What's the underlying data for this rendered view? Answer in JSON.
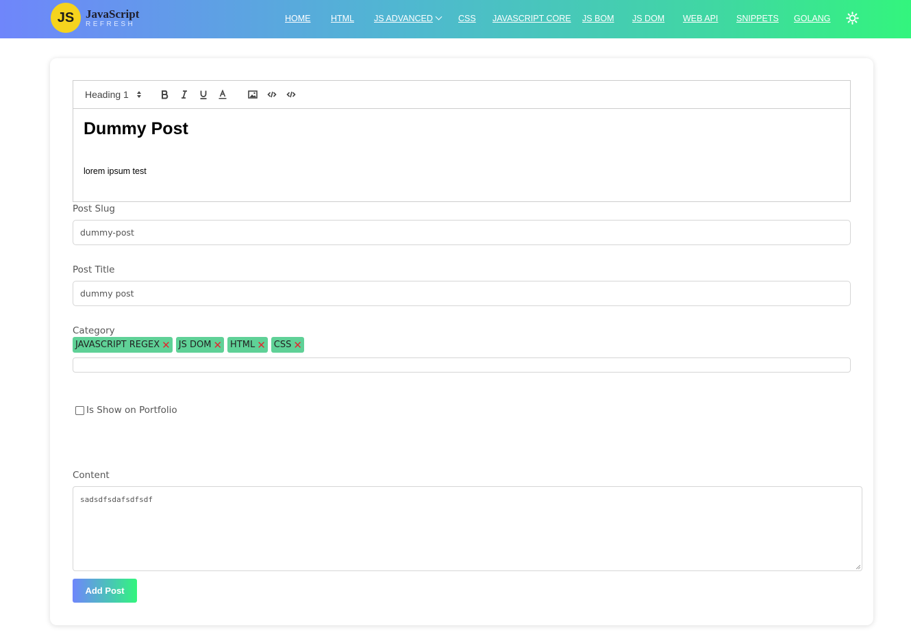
{
  "brand": {
    "badge": "JS",
    "title": "JavaScript",
    "subtitle": "REFRESH"
  },
  "nav": {
    "items": [
      {
        "label": "HOME"
      },
      {
        "label": "HTML"
      },
      {
        "label": "JS ADVANCED"
      },
      {
        "label": "CSS"
      },
      {
        "label": "JAVASCRIPT CORE"
      },
      {
        "label": "JS BOM"
      },
      {
        "label": "JS DOM"
      },
      {
        "label": "WEB API"
      },
      {
        "label": "SNIPPETS"
      },
      {
        "label": "GOLANG"
      }
    ],
    "theme_icon": "sun-icon"
  },
  "editor": {
    "heading_select": "Heading 1",
    "toolbar_icons": [
      "bold-icon",
      "italic-icon",
      "underline-icon",
      "text-color-icon",
      "image-icon",
      "code-icon",
      "code-block-icon"
    ],
    "heading_text": "Dummy Post",
    "paragraph_text": "lorem ipsum test"
  },
  "form": {
    "slug_label": "Post Slug",
    "slug_value": "dummy-post",
    "title_label": "Post Title",
    "title_value": "dummy post",
    "category_label": "Category",
    "categories": [
      {
        "label": "JAVASCRIPT REGEX"
      },
      {
        "label": "JS DOM"
      },
      {
        "label": "HTML"
      },
      {
        "label": "CSS"
      }
    ],
    "remove_glyph": "✕",
    "portfolio_label": "Is Show on Portfolio",
    "portfolio_checked": false,
    "content_label": "Content",
    "content_value": "sadsdfsdafsdfsdf",
    "submit_label": "Add Post"
  },
  "colors": {
    "gradient_start": "#6f86fb",
    "gradient_end": "#33f57d",
    "tag_bg": "#5fd197",
    "remove_x": "#e0282e",
    "logo_badge": "#f5d31e"
  }
}
